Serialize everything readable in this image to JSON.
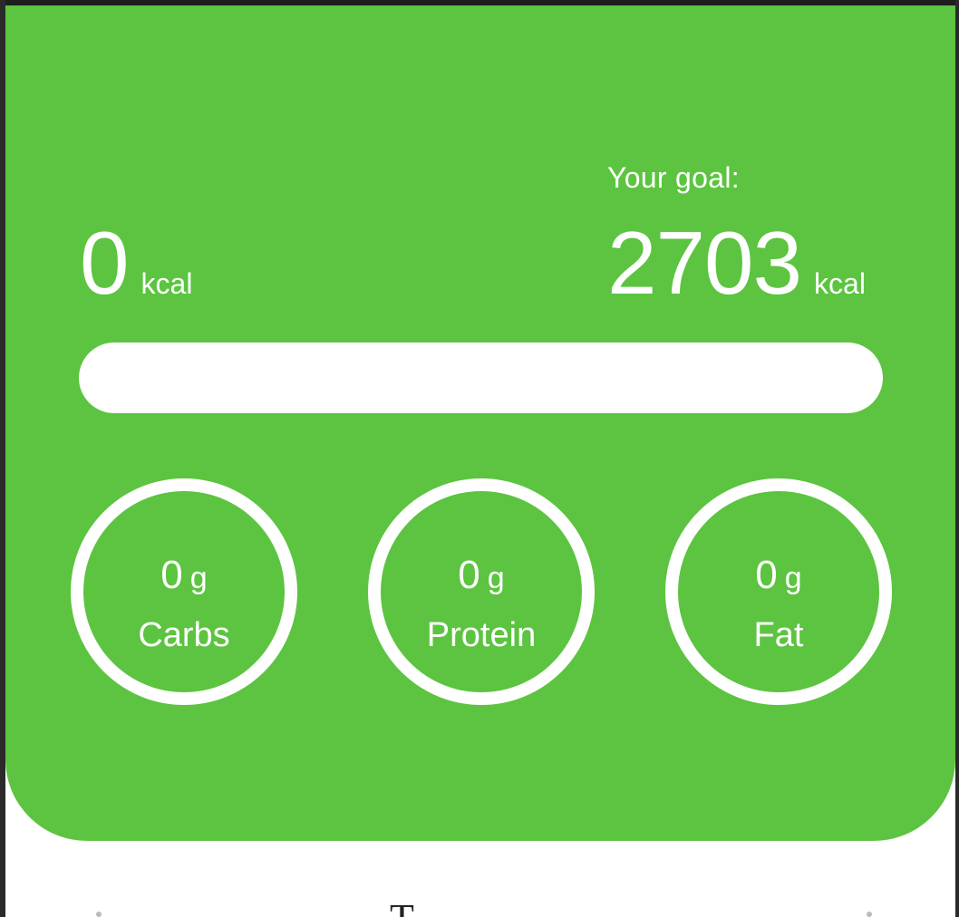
{
  "header": {
    "consumed": {
      "value": "0",
      "unit": "kcal"
    },
    "goal": {
      "label": "Your goal:",
      "value": "2703",
      "unit": "kcal"
    },
    "progress": {
      "fraction": 0
    }
  },
  "macros": [
    {
      "value": "0",
      "unit": "g",
      "name": "Carbs"
    },
    {
      "value": "0",
      "unit": "g",
      "name": "Protein"
    },
    {
      "value": "0",
      "unit": "g",
      "name": "Fat"
    }
  ],
  "colors": {
    "header_bg": "#5cc440",
    "text": "#ffffff",
    "track": "#ffffff"
  },
  "below": {
    "title_partial": "T"
  }
}
